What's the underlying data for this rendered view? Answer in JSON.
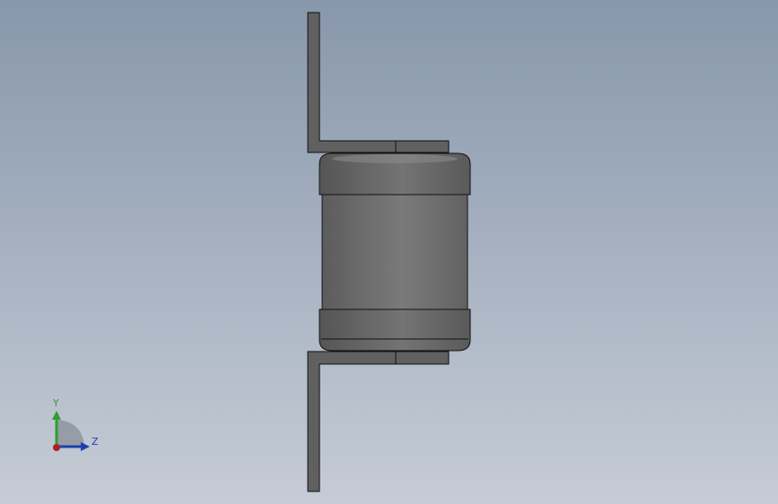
{
  "viewport": {
    "background_top": "#8897ab",
    "background_bottom": "#c6ccd6"
  },
  "part": {
    "body_color": "#6d6d6d",
    "lead_color": "#5f5f5f",
    "edge_color": "#111111"
  },
  "triad": {
    "y_label": "Y",
    "z_label": "Z",
    "y_color": "#2e9e2e",
    "z_color": "#1f3fb0",
    "x_color": "#b01f1f"
  }
}
